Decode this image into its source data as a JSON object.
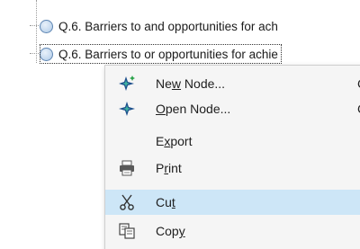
{
  "tree": {
    "rows": [
      {
        "label": "Q.6. Barriers to and opportunities for ach",
        "selected": false
      },
      {
        "label": "Q.6. Barriers to or opportunities for achie",
        "selected": true
      }
    ]
  },
  "context_menu": {
    "items": [
      {
        "pre": "Ne",
        "mn": "w",
        "post": " Node...",
        "shortcut": "C",
        "icon": "new-node-icon"
      },
      {
        "pre": "",
        "mn": "O",
        "post": "pen Node...",
        "shortcut": "C",
        "icon": "open-node-icon"
      },
      {
        "pre": "E",
        "mn": "x",
        "post": "port",
        "shortcut": "",
        "icon": ""
      },
      {
        "pre": "P",
        "mn": "r",
        "post": "int",
        "shortcut": "",
        "icon": "print-icon"
      },
      {
        "pre": "Cu",
        "mn": "t",
        "post": "",
        "shortcut": "",
        "icon": "cut-icon",
        "hover": true
      },
      {
        "pre": "Cop",
        "mn": "y",
        "post": "",
        "shortcut": "",
        "icon": "copy-icon"
      }
    ]
  }
}
